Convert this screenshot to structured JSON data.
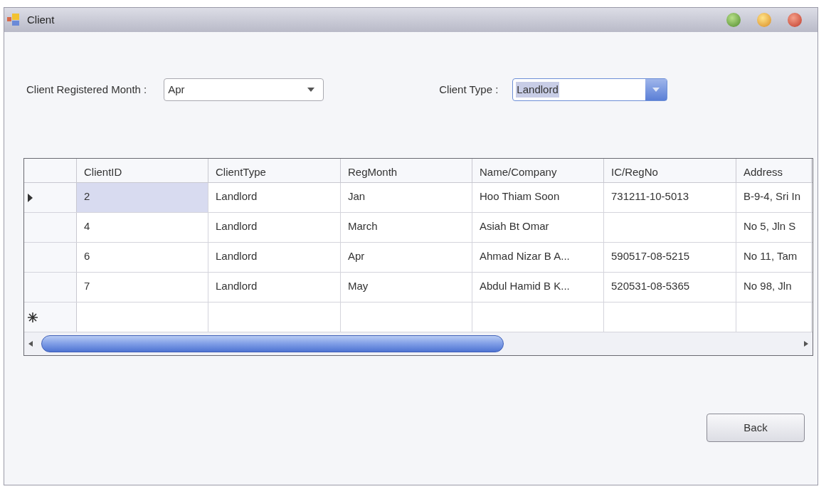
{
  "window": {
    "title": "Client"
  },
  "filters": [
    {
      "label": "Client Registered Month :",
      "value": "Apr",
      "focused": false
    },
    {
      "label": "Client Type :",
      "value": "Landlord",
      "focused": true
    }
  ],
  "table": {
    "columns": [
      "ClientID",
      "ClientType",
      "RegMonth",
      "Name/Company",
      "IC/RegNo",
      "Address"
    ],
    "rows": [
      {
        "kind": "data",
        "selected": true,
        "cells": [
          "2",
          "Landlord",
          "Jan",
          "Hoo Thiam Soon",
          "731211-10-5013",
          "B-9-4, Sri In"
        ]
      },
      {
        "kind": "data",
        "selected": false,
        "cells": [
          "4",
          "Landlord",
          "March",
          "Asiah Bt Omar",
          "",
          "No 5, Jln S"
        ]
      },
      {
        "kind": "data",
        "selected": false,
        "cells": [
          "6",
          "Landlord",
          "Apr",
          "Ahmad Nizar B A...",
          "590517-08-5215",
          "No 11, Tam"
        ]
      },
      {
        "kind": "data",
        "selected": false,
        "cells": [
          "7",
          "Landlord",
          "May",
          "Abdul Hamid B K...",
          "520531-08-5365",
          "No 98, Jln"
        ]
      },
      {
        "kind": "new",
        "selected": false,
        "cells": [
          "",
          "",
          "",
          "",
          "",
          ""
        ]
      }
    ]
  },
  "buttons": [
    "Back"
  ]
}
